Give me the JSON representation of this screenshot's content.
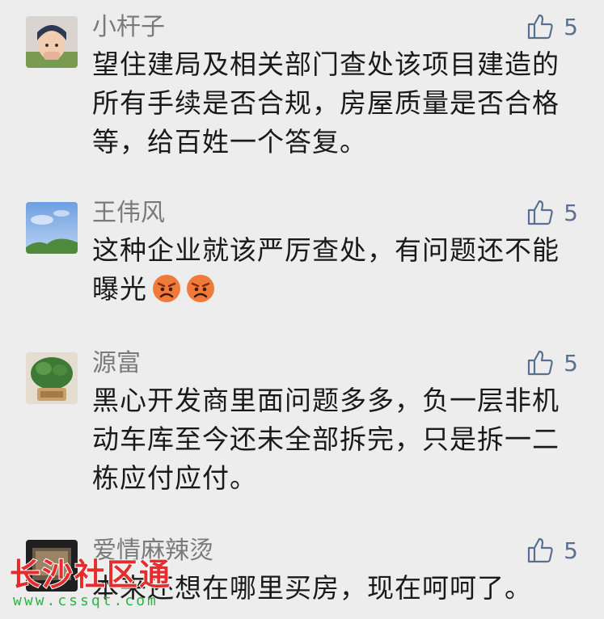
{
  "comments": [
    {
      "name": "小杆子",
      "likes": "5",
      "lines": [
        "望住建局及相关部门查处该项目建造的",
        "所有手续是否合规，房屋质量是否合格",
        "等，给百姓一个答复。"
      ]
    },
    {
      "name": "王伟风",
      "likes": "5",
      "lines": [
        "这种企业就该严厉查处，有问题还不能",
        "曝光"
      ]
    },
    {
      "name": "源富",
      "likes": "5",
      "lines": [
        "黑心开发商里面问题多多，负一层非机",
        "动车库至今还未全部拆完，只是拆一二",
        "栋应付应付。"
      ]
    },
    {
      "name": "爱情麻辣烫",
      "likes": "5",
      "lines": [
        "本来还想在哪里买房，现在呵呵了。"
      ]
    }
  ],
  "watermark": {
    "title": "长沙社区通",
    "url": "www.cssqt.com"
  },
  "icons": {
    "like": "thumbs-up-icon",
    "emoji": "angry-face-icon"
  },
  "colors": {
    "background": "#ededed",
    "name": "#7a7a7a",
    "like": "#5a6f93",
    "watermark_red": "#e52d2d",
    "watermark_green": "#2fb14a"
  }
}
